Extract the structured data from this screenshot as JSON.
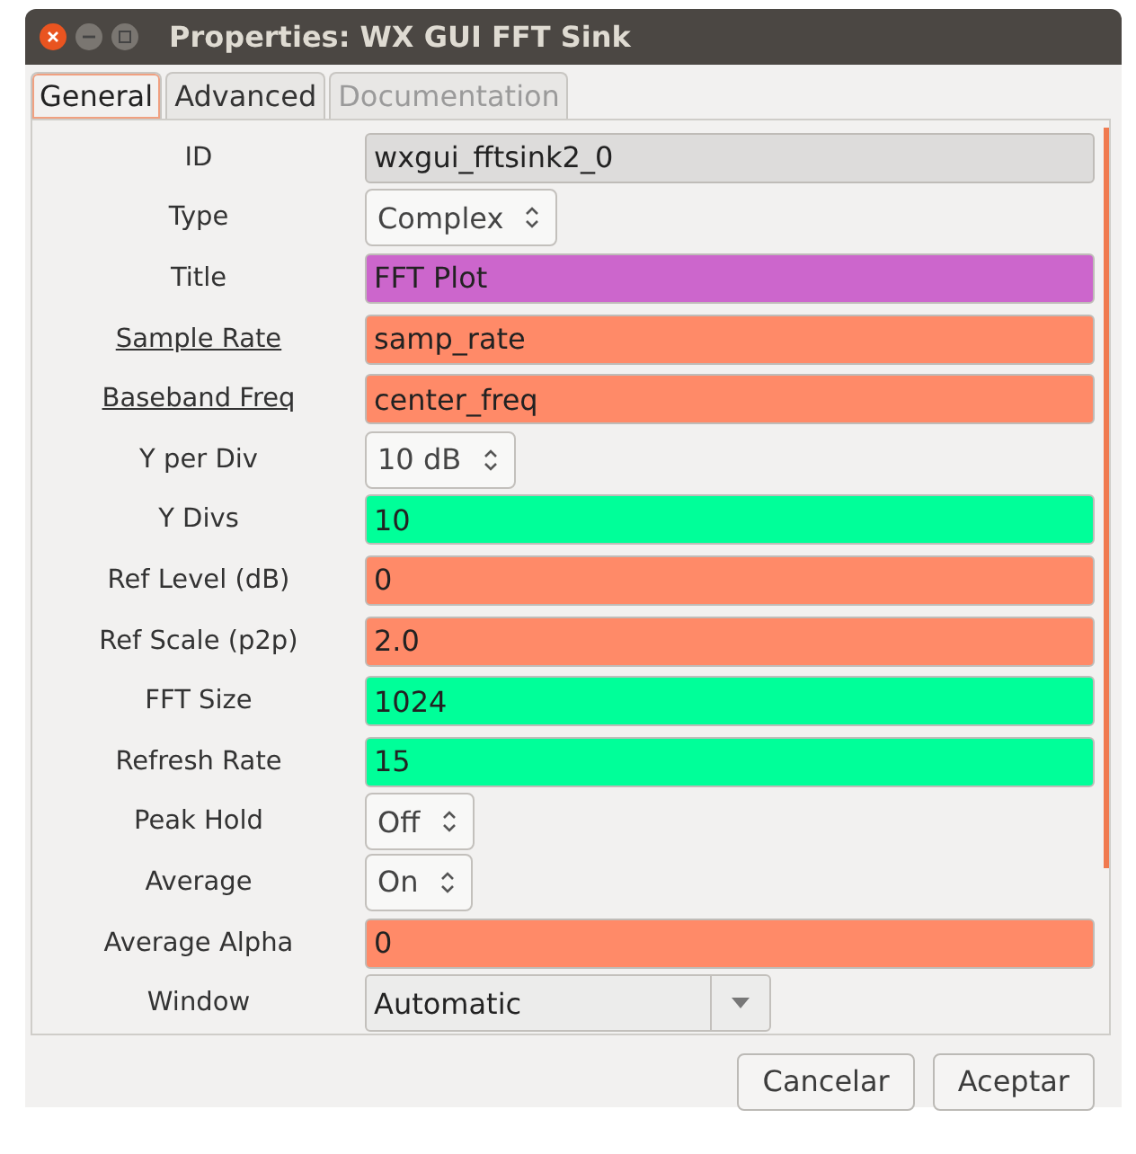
{
  "window": {
    "title": "Properties: WX GUI FFT Sink"
  },
  "tabs": [
    {
      "label": "General",
      "selected": true,
      "disabled": false
    },
    {
      "label": "Advanced",
      "selected": false,
      "disabled": false
    },
    {
      "label": "Documentation",
      "selected": false,
      "disabled": true
    }
  ],
  "fields": [
    {
      "label": "ID",
      "underlined": false,
      "kind": "text",
      "value": "wxgui_fftsink2_0",
      "color": "#dddcdb"
    },
    {
      "label": "Type",
      "underlined": false,
      "kind": "spinner",
      "value": "Complex"
    },
    {
      "label": "Title",
      "underlined": false,
      "kind": "text",
      "value": "FFT Plot",
      "color": "#cc66cc"
    },
    {
      "label": "Sample Rate",
      "underlined": true,
      "kind": "text",
      "value": "samp_rate",
      "color": "#ff8a68"
    },
    {
      "label": "Baseband Freq",
      "underlined": true,
      "kind": "text",
      "value": "center_freq",
      "color": "#ff8a68"
    },
    {
      "label": "Y per Div",
      "underlined": false,
      "kind": "spinner",
      "value": "10 dB"
    },
    {
      "label": "Y Divs",
      "underlined": false,
      "kind": "text",
      "value": "10",
      "color": "#00ff99"
    },
    {
      "label": "Ref Level (dB)",
      "underlined": false,
      "kind": "text",
      "value": "0",
      "color": "#ff8a68"
    },
    {
      "label": "Ref Scale (p2p)",
      "underlined": false,
      "kind": "text",
      "value": "2.0",
      "color": "#ff8a68"
    },
    {
      "label": "FFT Size",
      "underlined": false,
      "kind": "text",
      "value": "1024",
      "color": "#00ff99"
    },
    {
      "label": "Refresh Rate",
      "underlined": false,
      "kind": "text",
      "value": "15",
      "color": "#00ff99"
    },
    {
      "label": "Peak Hold",
      "underlined": false,
      "kind": "spinner",
      "value": "Off"
    },
    {
      "label": "Average",
      "underlined": false,
      "kind": "spinner",
      "value": "On"
    },
    {
      "label": "Average Alpha",
      "underlined": false,
      "kind": "text",
      "value": "0",
      "color": "#ff8a68"
    },
    {
      "label": "Window",
      "underlined": false,
      "kind": "combo",
      "value": "Automatic"
    }
  ],
  "buttons": [
    "Cancelar",
    "Aceptar"
  ]
}
